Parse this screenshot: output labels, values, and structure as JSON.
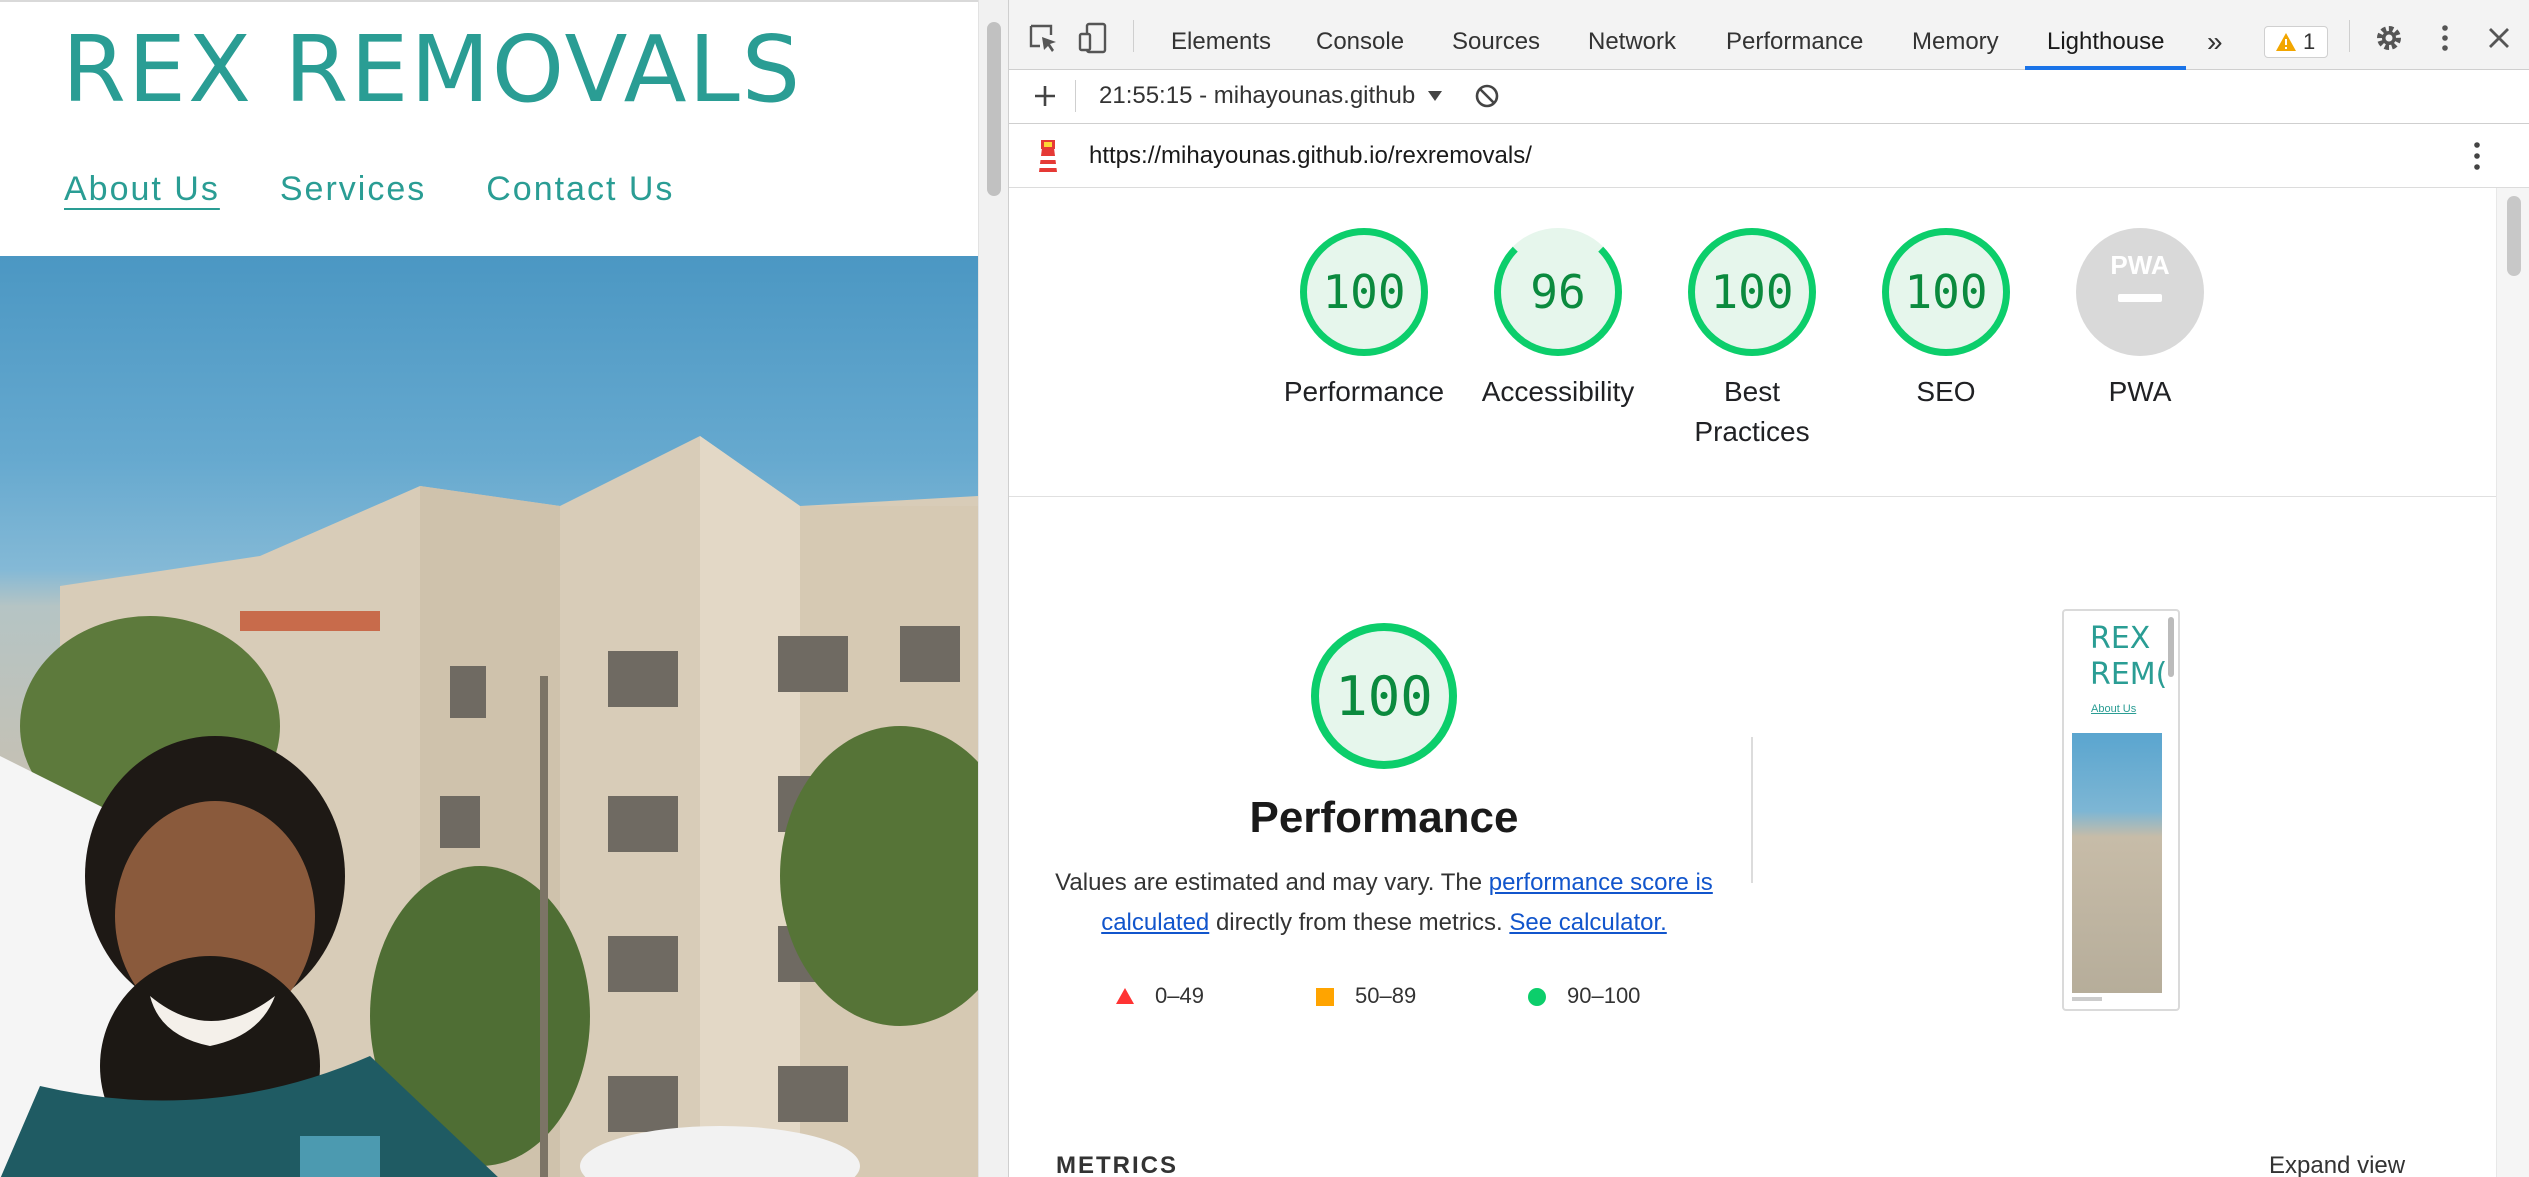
{
  "website": {
    "logo": "REX REMOVALS",
    "nav": [
      {
        "label": "About Us",
        "active": true
      },
      {
        "label": "Services",
        "active": false
      },
      {
        "label": "Contact Us",
        "active": false
      }
    ],
    "brand_color": "#2a9d94"
  },
  "devtools": {
    "tabs": [
      "Elements",
      "Console",
      "Sources",
      "Network",
      "Performance",
      "Memory",
      "Lighthouse"
    ],
    "active_tab": "Lighthouse",
    "more_tabs_label": "»",
    "warning_count": "1",
    "run_label": "21:55:15 - mihayounas.github",
    "report_url": "https://mihayounas.github.io/rexremovals/",
    "accent_color": "#1a73e8"
  },
  "scores": [
    {
      "label": "Performance",
      "value": "100"
    },
    {
      "label": "Accessibility",
      "value": "96"
    },
    {
      "label": "Best Practices",
      "value": "100"
    },
    {
      "label": "SEO",
      "value": "100"
    },
    {
      "label": "PWA",
      "value": "PWA"
    }
  ],
  "performance_section": {
    "score": "100",
    "title": "Performance",
    "desc_prefix": "Values are estimated and may vary. The ",
    "link_score": "performance score is calculated",
    "desc_middle": " directly from these metrics. ",
    "link_calc": "See calculator.",
    "legend": [
      {
        "range": "0–49",
        "color": "#ff3333"
      },
      {
        "range": "50–89",
        "color": "#ffa400"
      },
      {
        "range": "90–100",
        "color": "#0cce6b"
      }
    ],
    "thumbnail": {
      "logo_line1": "REX",
      "logo_line2": "REM(",
      "link": "About Us"
    }
  },
  "metrics_heading": "METRICS",
  "expand_view": "Expand view",
  "colors": {
    "pass": "#0cce6b",
    "pass_text": "#0b8a3e",
    "pass_bg": "#e6f6ec"
  }
}
